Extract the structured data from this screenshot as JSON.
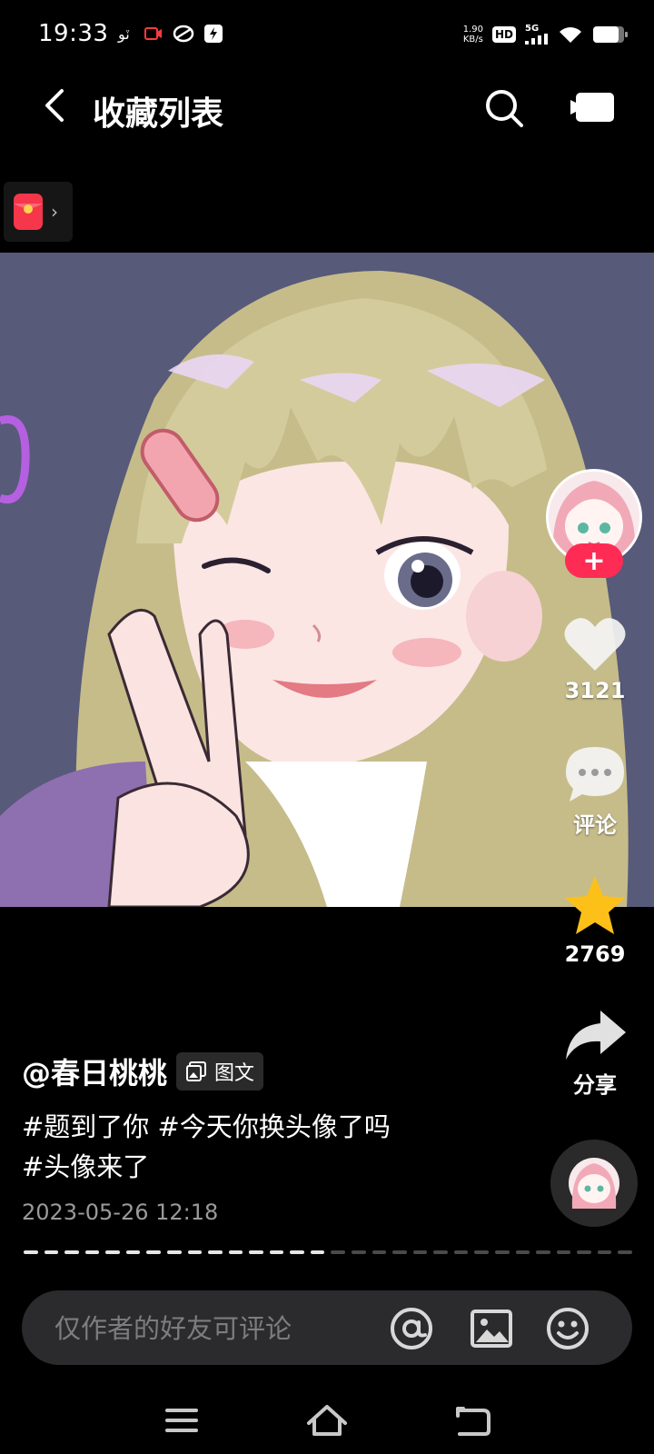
{
  "status_bar": {
    "time": "19:33",
    "speed_value": "1.90",
    "speed_unit": "KB/s",
    "hd": "HD",
    "network": "5G"
  },
  "header": {
    "title": "收藏列表"
  },
  "post": {
    "author": "@春日桃桃",
    "type_badge": "图文",
    "caption_line1": "#题到了你 #今天你换头像了吗",
    "caption_line2": "#头像来了",
    "date": "2023-05-26 12:18"
  },
  "actions": {
    "follow_label": "+",
    "likes": "3121",
    "comment_label": "评论",
    "favorites": "2769",
    "share_label": "分享"
  },
  "comment_bar": {
    "placeholder": "仅作者的好友可评论"
  },
  "progress": {
    "total_segments": 30,
    "filled_segments": 15
  },
  "colors": {
    "accent_red": "#fe2c55",
    "star_yellow": "#fcc018",
    "background": "#000000"
  }
}
